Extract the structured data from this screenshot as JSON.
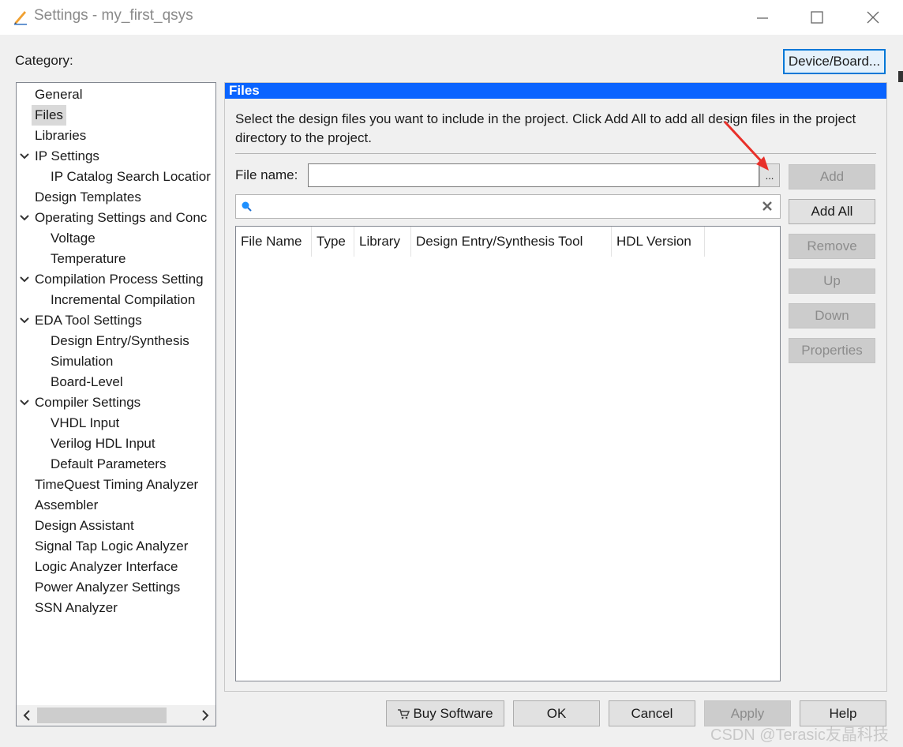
{
  "window": {
    "title": "Settings - my_first_qsys",
    "minimize_icon": "minimize-icon",
    "maximize_icon": "maximize-icon",
    "close_icon": "close-icon"
  },
  "category_label": "Category:",
  "device_board_button": "Device/Board...",
  "tree": {
    "selected": "Files",
    "items": [
      {
        "label": "General",
        "indent": 0,
        "expandable": false
      },
      {
        "label": "Files",
        "indent": 0,
        "expandable": false
      },
      {
        "label": "Libraries",
        "indent": 0,
        "expandable": false
      },
      {
        "label": "IP Settings",
        "indent": 0,
        "expandable": true
      },
      {
        "label": "IP Catalog Search Locatior",
        "indent": 1,
        "expandable": false
      },
      {
        "label": "Design Templates",
        "indent": 0,
        "expandable": false
      },
      {
        "label": "Operating Settings and Conc",
        "indent": 0,
        "expandable": true
      },
      {
        "label": "Voltage",
        "indent": 1,
        "expandable": false
      },
      {
        "label": "Temperature",
        "indent": 1,
        "expandable": false
      },
      {
        "label": "Compilation Process Setting",
        "indent": 0,
        "expandable": true
      },
      {
        "label": "Incremental Compilation",
        "indent": 1,
        "expandable": false
      },
      {
        "label": "EDA Tool Settings",
        "indent": 0,
        "expandable": true
      },
      {
        "label": "Design Entry/Synthesis",
        "indent": 1,
        "expandable": false
      },
      {
        "label": "Simulation",
        "indent": 1,
        "expandable": false
      },
      {
        "label": "Board-Level",
        "indent": 1,
        "expandable": false
      },
      {
        "label": "Compiler Settings",
        "indent": 0,
        "expandable": true
      },
      {
        "label": "VHDL Input",
        "indent": 1,
        "expandable": false
      },
      {
        "label": "Verilog HDL Input",
        "indent": 1,
        "expandable": false
      },
      {
        "label": "Default Parameters",
        "indent": 1,
        "expandable": false
      },
      {
        "label": "TimeQuest Timing Analyzer",
        "indent": 0,
        "expandable": false
      },
      {
        "label": "Assembler",
        "indent": 0,
        "expandable": false
      },
      {
        "label": "Design Assistant",
        "indent": 0,
        "expandable": false
      },
      {
        "label": "Signal Tap Logic Analyzer",
        "indent": 0,
        "expandable": false
      },
      {
        "label": "Logic Analyzer Interface",
        "indent": 0,
        "expandable": false
      },
      {
        "label": "Power Analyzer Settings",
        "indent": 0,
        "expandable": false
      },
      {
        "label": "SSN Analyzer",
        "indent": 0,
        "expandable": false
      }
    ]
  },
  "files_panel": {
    "header": "Files",
    "description": "Select the design files you want to include in the project. Click Add All to add all design files in the project directory to the project.",
    "file_name_label": "File name:",
    "file_name_value": "",
    "browse_label": "...",
    "search_value": "",
    "table_columns": [
      "File Name",
      "Type",
      "Library",
      "Design Entry/Synthesis Tool",
      "HDL Version"
    ],
    "table_rows": [],
    "buttons": {
      "add": "Add",
      "add_all": "Add All",
      "remove": "Remove",
      "up": "Up",
      "down": "Down",
      "properties": "Properties"
    }
  },
  "footer": {
    "buy_software": "Buy Software",
    "ok": "OK",
    "cancel": "Cancel",
    "apply": "Apply",
    "help": "Help"
  },
  "watermark": "CSDN @Terasic友晶科技",
  "colors": {
    "header_blue": "#0a64ff",
    "selection_gray": "#d9d9d9",
    "annotation_arrow": "#e8302a",
    "focus_border": "#0078d7"
  }
}
